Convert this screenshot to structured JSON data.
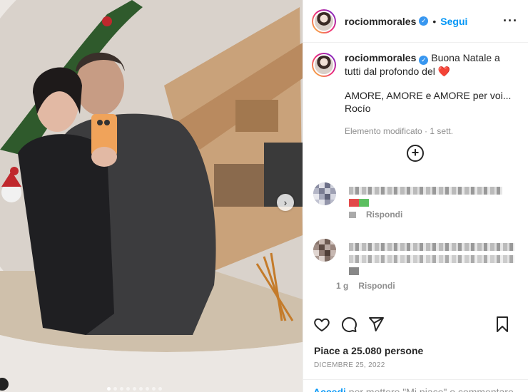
{
  "post": {
    "username": "rociommorales",
    "follow_label": "Segui",
    "more_icon": "more-icon",
    "caption_line1": "Buona Natale a tutti dal profondo del ❤️",
    "caption_line2": "AMORE, AMORE e AMORE per voi... Rocío",
    "caption_meta": "Elemento modificato · 1 sett.",
    "comments": [
      {
        "reply_label": "Rispondi",
        "time": ""
      },
      {
        "reply_label": "Rispondi",
        "time": "1 g"
      }
    ],
    "likes": "Piace a 25.080 persone",
    "date": "DICEMBRE 25, 2022",
    "footer_login": "Accedi",
    "footer_rest": " per mettere \"Mi piace\" o commentare."
  },
  "colors": {
    "accent": "#0095f6",
    "verified": "#3897f0",
    "muted": "#8e8e8e"
  }
}
